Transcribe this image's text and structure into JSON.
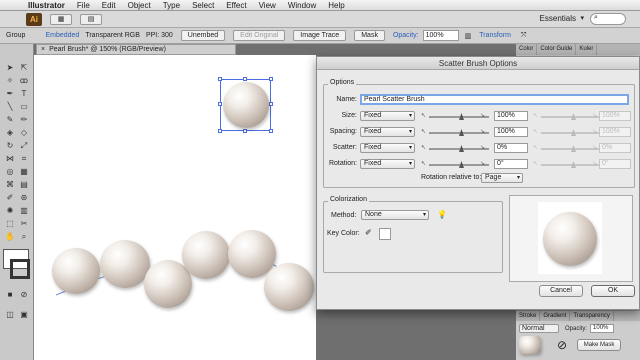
{
  "menubar": {
    "apple": "",
    "app_name": "Illustrator",
    "items": [
      "File",
      "Edit",
      "Object",
      "Type",
      "Select",
      "Effect",
      "View",
      "Window",
      "Help"
    ]
  },
  "appbar": {
    "logo": "Ai",
    "workspace": "Essentials",
    "workspace_arrow": "▾"
  },
  "controlbar": {
    "group_label": "Group",
    "embedded": "Embedded",
    "color_mode": "Transparent RGB",
    "ppi": "PPI: 300",
    "unembed": "Unembed",
    "edit_original": "Edit Original",
    "image_trace": "Image Trace",
    "mask": "Mask",
    "opacity_label": "Opacity:",
    "opacity_value": "100%",
    "transform": "Transform"
  },
  "document_tab": {
    "close": "×",
    "title": "Pearl Brush* @ 150% (RGB/Preview)"
  },
  "right_panels": {
    "top_tabs": [
      "Color",
      "Color Guide",
      "Kuler"
    ],
    "bottom_tabs": [
      "Stroke",
      "Gradient",
      "Transparency"
    ],
    "blend_mode": "Normal",
    "opacity_label": "Opacity:",
    "opacity_value": "100%",
    "make_mask": "Make Mask"
  },
  "dialog": {
    "title": "Scatter Brush Options",
    "options_legend": "Options",
    "name_label": "Name:",
    "name_value": "Pearl Scatter Brush",
    "rows": [
      {
        "label": "Size:",
        "method": "Fixed",
        "value1": "100%",
        "value2": "100%"
      },
      {
        "label": "Spacing:",
        "method": "Fixed",
        "value1": "100%",
        "value2": "100%"
      },
      {
        "label": "Scatter:",
        "method": "Fixed",
        "value1": "0%",
        "value2": "0%"
      },
      {
        "label": "Rotation:",
        "method": "Fixed",
        "value1": "0°",
        "value2": "0°"
      }
    ],
    "rotation_relative_label": "Rotation relative to:",
    "rotation_relative_value": "Page",
    "colorization_legend": "Colorization",
    "method_label": "Method:",
    "method_value": "None",
    "key_color_label": "Key Color:",
    "cancel_label": "Cancel",
    "ok_label": "OK"
  }
}
